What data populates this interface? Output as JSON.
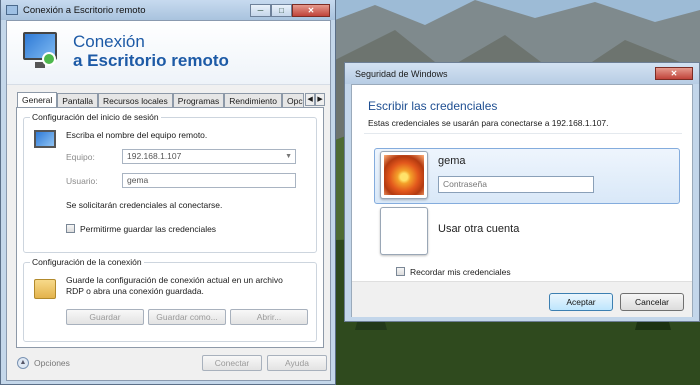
{
  "rdp_window": {
    "title": "Conexión a Escritorio remoto",
    "banner_line1": "Conexión",
    "banner_line2": "a Escritorio remoto",
    "tabs": [
      "General",
      "Pantalla",
      "Recursos locales",
      "Programas",
      "Rendimiento",
      "Opcio"
    ],
    "login_group": {
      "title": "Configuración del inicio de sesión",
      "instruction": "Escriba el nombre del equipo remoto.",
      "computer_label": "Equipo:",
      "computer_value": "192.168.1.107",
      "user_label": "Usuario:",
      "user_value": "gema",
      "note": "Se solicitarán credenciales al conectarse.",
      "allow_save_label": "Permitirme guardar las credenciales"
    },
    "connection_group": {
      "title": "Configuración de la conexión",
      "desc_line1": "Guarde la configuración de conexión actual en un archivo",
      "desc_line2": "RDP o abra una conexión guardada.",
      "save_label": "Guardar",
      "save_as_label": "Guardar como...",
      "open_label": "Abrir..."
    },
    "options_label": "Opciones",
    "connect_label": "Conectar",
    "help_label": "Ayuda"
  },
  "security_dialog": {
    "title": "Seguridad de Windows",
    "heading": "Escribir las credenciales",
    "subtitle": "Estas credenciales se usarán para conectarse a 192.168.1.107.",
    "user_name": "gema",
    "password_placeholder": "Contraseña",
    "other_account_label": "Usar otra cuenta",
    "remember_label": "Recordar mis credenciales",
    "accept_label": "Aceptar",
    "cancel_label": "Cancelar"
  }
}
